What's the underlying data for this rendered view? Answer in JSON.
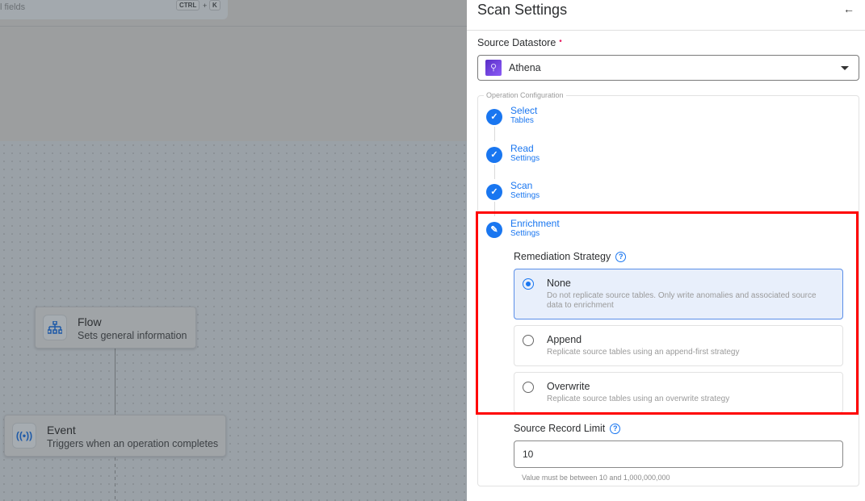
{
  "background": {
    "search": {
      "placeholder_fragment": "l fields",
      "shortcut_keys": [
        "CTRL",
        "K"
      ],
      "plus": "+"
    },
    "nodes": [
      {
        "title": "Flow",
        "subtitle": "Sets general information",
        "icon": "sitemap-icon"
      },
      {
        "title": "Event",
        "subtitle": "Triggers when an operation completes",
        "icon": "broadcast-icon"
      }
    ]
  },
  "panel": {
    "title": "Scan Settings",
    "back_icon": "arrow-left-icon",
    "source_datastore": {
      "label": "Source Datastore",
      "required_mark": "•",
      "value": "Athena"
    },
    "operation_configuration": {
      "legend": "Operation Configuration",
      "steps": [
        {
          "title": "Select",
          "subtitle": "Tables",
          "status": "complete"
        },
        {
          "title": "Read",
          "subtitle": "Settings",
          "status": "complete"
        },
        {
          "title": "Scan",
          "subtitle": "Settings",
          "status": "complete"
        },
        {
          "title": "Enrichment",
          "subtitle": "Settings",
          "status": "editing"
        }
      ],
      "remediation": {
        "label": "Remediation Strategy",
        "help": "?",
        "options": [
          {
            "title": "None",
            "description": "Do not replicate source tables. Only write anomalies and associated source data to enrichment",
            "selected": true
          },
          {
            "title": "Append",
            "description": "Replicate source tables using an append-first strategy",
            "selected": false
          },
          {
            "title": "Overwrite",
            "description": "Replicate source tables using an overwrite strategy",
            "selected": false
          }
        ]
      },
      "record_limit": {
        "label": "Source Record Limit",
        "help": "?",
        "value": "10",
        "hint": "Value must be between 10 and 1,000,000,000"
      }
    }
  },
  "colors": {
    "accent": "#1976f0",
    "highlight": "#ff0000",
    "required": "#e91e63"
  }
}
